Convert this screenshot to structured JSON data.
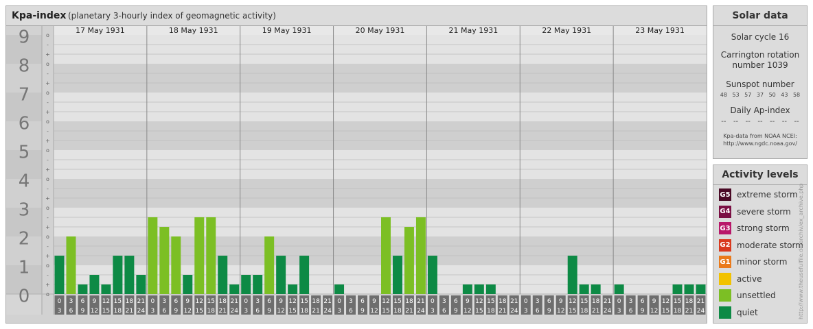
{
  "header": {
    "title": "Kpa-index",
    "subtitle": "(planetary 3-hourly index of geomagnetic activity)"
  },
  "chart_data": {
    "type": "bar",
    "ylim": [
      0,
      9
    ],
    "y_tick_labels": [
      "0",
      "1",
      "2",
      "3",
      "4",
      "5",
      "6",
      "7",
      "8",
      "9"
    ],
    "sub_tick_labels": [
      "o",
      "+",
      "-",
      "o",
      "+",
      "-",
      "o",
      "+",
      "-",
      "o",
      "+",
      "-",
      "o",
      "+",
      "-",
      "o",
      "+",
      "-",
      "o",
      "+",
      "-",
      "o",
      "+",
      "-",
      "o",
      "+",
      "-",
      "o"
    ],
    "days": [
      "17 May 1931",
      "18 May 1931",
      "19 May 1931",
      "20 May 1931",
      "21 May 1931",
      "22 May 1931",
      "23 May 1931"
    ],
    "interval_labels_top": [
      "0",
      "3",
      "6",
      "9",
      "12",
      "15",
      "18",
      "21"
    ],
    "interval_labels_bottom": [
      "3",
      "6",
      "9",
      "12",
      "15",
      "18",
      "21",
      "24"
    ],
    "values": [
      [
        1.333,
        2.0,
        0.333,
        0.667,
        0.333,
        1.333,
        1.333,
        0.667
      ],
      [
        2.667,
        2.333,
        2.0,
        0.667,
        2.667,
        2.667,
        1.333,
        0.333
      ],
      [
        0.667,
        0.667,
        2.0,
        1.333,
        0.333,
        1.333,
        0.0,
        0.0
      ],
      [
        0.333,
        0.0,
        0.0,
        0.0,
        2.667,
        1.333,
        2.333,
        2.667
      ],
      [
        1.333,
        0.0,
        0.0,
        0.333,
        0.333,
        0.333,
        0.0,
        0.0
      ],
      [
        0.0,
        0.0,
        0.0,
        0.0,
        1.333,
        0.333,
        0.333,
        0.0
      ],
      [
        0.333,
        0.0,
        0.0,
        0.0,
        0.0,
        0.333,
        0.333,
        0.333
      ]
    ],
    "colors": {
      "quiet": "#0d8a45",
      "unsettled": "#7cbf24",
      "active": "#f2c200"
    }
  },
  "solar": {
    "title": "Solar data",
    "cycle": "Solar cycle 16",
    "carrington_line1": "Carrington rotation",
    "carrington_line2": "number 1039",
    "sunspot_label": "Sunspot number",
    "sunspot_values": [
      "48",
      "53",
      "57",
      "37",
      "50",
      "43",
      "58"
    ],
    "ap_label": "Daily Ap-index",
    "ap_values": [
      "--",
      "--",
      "--",
      "--",
      "--",
      "--",
      "--"
    ],
    "source_line1": "Kpa-data from NOAA NCEI:",
    "source_line2": "http://www.ngdc.noaa.gov/"
  },
  "activity": {
    "title": "Activity levels",
    "levels": [
      {
        "badge": "G5",
        "label": "extreme storm",
        "color": "#4a0a26"
      },
      {
        "badge": "G4",
        "label": "severe storm",
        "color": "#7a0f43"
      },
      {
        "badge": "G3",
        "label": "strong storm",
        "color": "#b8186a"
      },
      {
        "badge": "G2",
        "label": "moderate storm",
        "color": "#d9381e"
      },
      {
        "badge": "G1",
        "label": "minor storm",
        "color": "#ea7a1a"
      },
      {
        "badge": "",
        "label": "active",
        "color": "#f2c200"
      },
      {
        "badge": "",
        "label": "unsettled",
        "color": "#7cbf24"
      },
      {
        "badge": "",
        "label": "quiet",
        "color": "#0d8a45"
      }
    ]
  },
  "watermark": "http://www.theusefulfile.de/archiv/ex_archive.php"
}
